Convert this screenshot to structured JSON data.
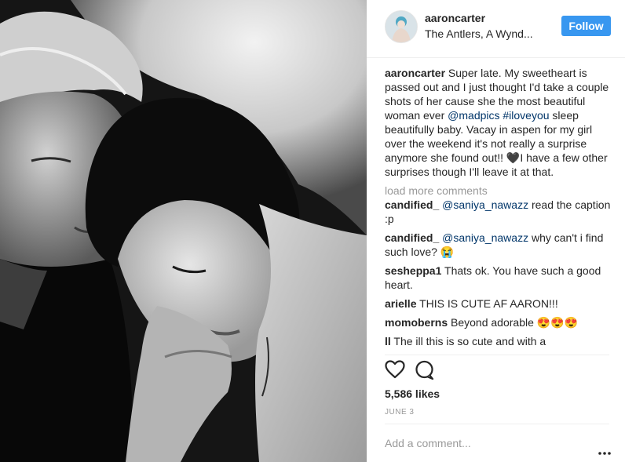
{
  "header": {
    "username": "aaroncarter",
    "location": "The Antlers, A Wynd...",
    "follow_label": "Follow"
  },
  "caption": {
    "username": "aaroncarter",
    "text_1": " Super late. My sweetheart is passed out and I just thought I'd take a couple shots of her cause she the most beautiful woman ever ",
    "mention": "@madpics",
    "hashtag": "#iloveyou",
    "text_2": " sleep beautifully baby. Vacay in aspen for my girl over the weekend it's not really a surprise anymore she found out!! ",
    "emoji": "🖤",
    "text_3": "I have a few other surprises though I'll leave it at that."
  },
  "load_more": "load more comments",
  "comments": [
    {
      "user": "candified_",
      "mention": "@saniya_nawazz",
      "text": " read the caption :p"
    },
    {
      "user": "candified_",
      "mention": "@saniya_nawazz",
      "text": " why can't i find such love? 😭"
    },
    {
      "user": "sesheppa1",
      "mention": "",
      "text": " Thats ok. You have such a good heart."
    },
    {
      "user": "arielle",
      "mention": "",
      "text": " THIS IS CUTE AF AARON!!!"
    },
    {
      "user": "momoberns",
      "mention": "",
      "text": " Beyond adorable 😍😍😍"
    },
    {
      "user": "ll",
      "mention": "",
      "text": " The ill this is so cute and with a"
    }
  ],
  "likes": "5,586 likes",
  "date": "JUNE 3",
  "add_comment_placeholder": "Add a comment...",
  "icons": {
    "like": "heart-icon",
    "comment": "comment-icon",
    "more": "more-options-icon"
  },
  "colors": {
    "follow_button": "#3897f0",
    "link": "#003569",
    "muted": "#999999"
  }
}
